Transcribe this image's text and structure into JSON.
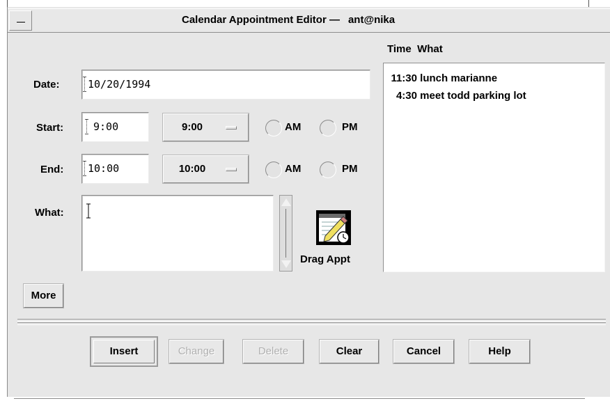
{
  "window": {
    "title": "Calendar Appointment Editor —",
    "user": "ant@nika"
  },
  "form": {
    "date_label": "Date:",
    "date_value": "10/20/1994",
    "start_label": "Start:",
    "start_value": "9:00",
    "start_menu": "9:00",
    "end_label": "End:",
    "end_value": "10:00",
    "end_menu": "10:00",
    "am_label": "AM",
    "pm_label": "PM",
    "what_label": "What:",
    "what_value": "",
    "drag_label": "Drag Appt",
    "more_label": "More"
  },
  "list": {
    "header_time": "Time",
    "header_what": "What",
    "items": [
      {
        "time": "11:30",
        "what": "lunch marianne"
      },
      {
        "time": "4:30",
        "what": "meet todd parking lot"
      }
    ]
  },
  "buttons": {
    "insert": "Insert",
    "change": "Change",
    "delete": "Delete",
    "clear": "Clear",
    "cancel": "Cancel",
    "help": "Help"
  },
  "icons": {
    "window_menu": "window-menu-icon",
    "drag": "drag-appointment-icon"
  }
}
